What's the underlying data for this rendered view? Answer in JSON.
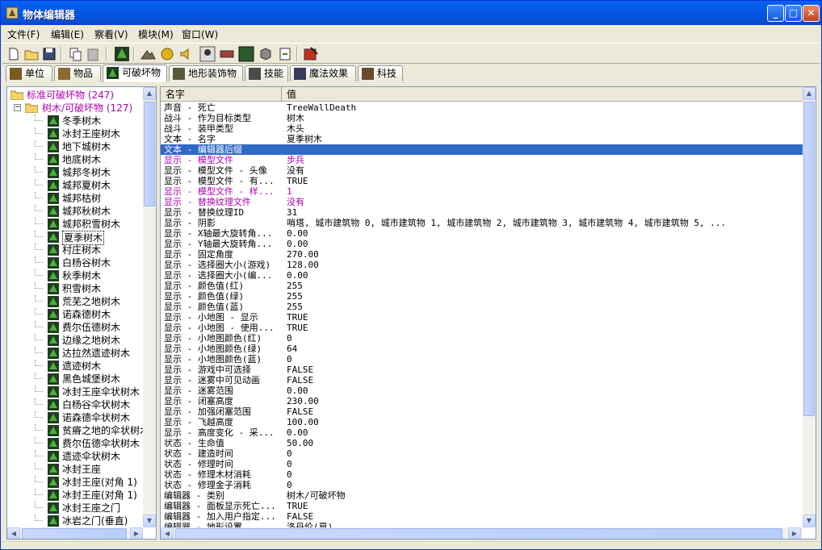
{
  "window": {
    "title": "物体编辑器"
  },
  "menu": [
    "文件(F)",
    "编辑(E)",
    "察看(V)",
    "模块(M)",
    "窗口(W)"
  ],
  "tabs": [
    {
      "label": "单位",
      "active": false
    },
    {
      "label": "物品",
      "active": false
    },
    {
      "label": "可破坏物",
      "active": true
    },
    {
      "label": "地形装饰物",
      "active": false
    },
    {
      "label": "技能",
      "active": false
    },
    {
      "label": "魔法效果",
      "active": false
    },
    {
      "label": "科技",
      "active": false
    }
  ],
  "tree": {
    "root": {
      "label": "标准可破坏物",
      "count": "(247)"
    },
    "category": {
      "label": "树木/可破坏物",
      "count": "(127)",
      "expander": "−"
    },
    "items": [
      "冬季树木",
      "冰封王座树木",
      "地下城树木",
      "地底树木",
      "城邦冬树木",
      "城邦夏树木",
      "城邦枯树",
      "城邦秋树木",
      "城邦积雪树木",
      "夏季树木",
      "村庄树木",
      "白杨谷树木",
      "秋季树木",
      "积雪树木",
      "荒芜之地树木",
      "诺森德树木",
      "费尔伍德树木",
      "边缘之地树木",
      "达拉然遗迹树木",
      "遗迹树木",
      "黑色城堡树木",
      "冰封王座伞状树木",
      "白杨谷伞状树木",
      "诺森德伞状树木",
      "贫瘠之地的伞状树木",
      "费尔伍德伞状树木",
      "遗迹伞状树木",
      "冰封王座",
      "冰封王座(对角 1)",
      "冰封王座(对角 1)",
      "冰封王座之门",
      "冰岩之门(垂直)"
    ],
    "selected_index": 9
  },
  "grid": {
    "headers": {
      "name": "名字",
      "value": "值"
    },
    "selected_index": 4,
    "rows": [
      {
        "name": "声音 - 死亡",
        "value": "TreeWallDeath",
        "mod": false
      },
      {
        "name": "战斗 - 作为目标类型",
        "value": "树木",
        "mod": false
      },
      {
        "name": "战斗 - 装甲类型",
        "value": "木头",
        "mod": false
      },
      {
        "name": "文本 - 名字",
        "value": "夏季树木",
        "mod": false
      },
      {
        "name": "文本 - 编辑器后缀",
        "value": "",
        "mod": false
      },
      {
        "name": "显示 - 模型文件",
        "value": "步兵",
        "mod": true
      },
      {
        "name": "显示 - 模型文件 - 头像",
        "value": "没有",
        "mod": false
      },
      {
        "name": "显示 - 模型文件 - 有...",
        "value": "TRUE",
        "mod": false
      },
      {
        "name": "显示 - 模型文件 - 样...",
        "value": "1",
        "mod": true
      },
      {
        "name": "显示 - 替换纹理文件",
        "value": "没有",
        "mod": true
      },
      {
        "name": "显示 - 替换纹理ID",
        "value": "31",
        "mod": false
      },
      {
        "name": "显示 - 阴影",
        "value": "哨塔, 城市建筑物 0, 城市建筑物 1, 城市建筑物 2, 城市建筑物 3, 城市建筑物 4, 城市建筑物 5, ...",
        "mod": false
      },
      {
        "name": "显示 - X轴最大旋转角...",
        "value": "0.00",
        "mod": false
      },
      {
        "name": "显示 - Y轴最大旋转角...",
        "value": "0.00",
        "mod": false
      },
      {
        "name": "显示 - 固定角度",
        "value": "270.00",
        "mod": false
      },
      {
        "name": "显示 - 选择圈大小(游戏)",
        "value": "128.00",
        "mod": false
      },
      {
        "name": "显示 - 选择圈大小(编...",
        "value": "0.00",
        "mod": false
      },
      {
        "name": "显示 - 颜色值(红)",
        "value": "255",
        "mod": false
      },
      {
        "name": "显示 - 颜色值(绿)",
        "value": "255",
        "mod": false
      },
      {
        "name": "显示 - 颜色值(蓝)",
        "value": "255",
        "mod": false
      },
      {
        "name": "显示 - 小地图 - 显示",
        "value": "TRUE",
        "mod": false
      },
      {
        "name": "显示 - 小地图 - 使用...",
        "value": "TRUE",
        "mod": false
      },
      {
        "name": "显示 - 小地图颜色(红)",
        "value": "0",
        "mod": false
      },
      {
        "name": "显示 - 小地图颜色(绿)",
        "value": "64",
        "mod": false
      },
      {
        "name": "显示 - 小地图颜色(蓝)",
        "value": "0",
        "mod": false
      },
      {
        "name": "显示 - 游戏中可选择",
        "value": "FALSE",
        "mod": false
      },
      {
        "name": "显示 - 迷雾中可见动画",
        "value": "FALSE",
        "mod": false
      },
      {
        "name": "显示 - 迷雾范围",
        "value": "0.00",
        "mod": false
      },
      {
        "name": "显示 - 闭塞高度",
        "value": "230.00",
        "mod": false
      },
      {
        "name": "显示 - 加强闭塞范围",
        "value": "FALSE",
        "mod": false
      },
      {
        "name": "显示 - 飞越高度",
        "value": "100.00",
        "mod": false
      },
      {
        "name": "显示 - 高度变化 - 采...",
        "value": "0.00",
        "mod": false
      },
      {
        "name": "状态 - 生命值",
        "value": "50.00",
        "mod": false
      },
      {
        "name": "状态 - 建造时间",
        "value": "0",
        "mod": false
      },
      {
        "name": "状态 - 修理时间",
        "value": "0",
        "mod": false
      },
      {
        "name": "状态 - 修理木材消耗",
        "value": "0",
        "mod": false
      },
      {
        "name": "状态 - 修理金子消耗",
        "value": "0",
        "mod": false
      },
      {
        "name": "编辑器 - 类别",
        "value": "树木/可破坏物",
        "mod": false
      },
      {
        "name": "编辑器 - 面板显示死亡...",
        "value": "TRUE",
        "mod": false
      },
      {
        "name": "编辑器 - 加入用户指定...",
        "value": "FALSE",
        "mod": false
      },
      {
        "name": "编辑器 - 地形设置",
        "value": "洛丹伦(夏)",
        "mod": false
      }
    ]
  },
  "colors": {
    "selection": "#316ac5",
    "modified": "#b000b0",
    "title_blue": "#0058e6"
  }
}
